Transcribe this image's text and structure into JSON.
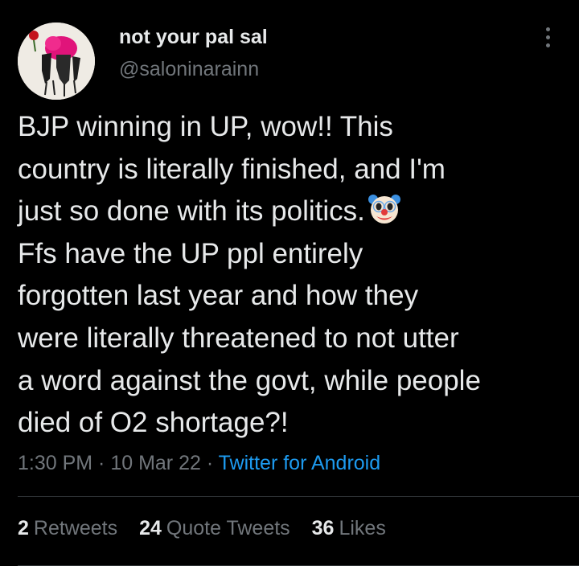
{
  "user": {
    "display_name": "not your pal sal",
    "handle": "@saloninarainn"
  },
  "tweet": {
    "lines": [
      "BJP winning in UP, wow!! This",
      "country is literally finished, and I'm",
      "just so done with its politics.",
      "Ffs have the UP ppl entirely",
      "forgotten last year and how they",
      "were literally threatened to not utter",
      "a word against the govt, while people",
      "died of O2 shortage?!"
    ],
    "emoji": "clown-face"
  },
  "meta": {
    "time": "1:30 PM",
    "sep1": " · ",
    "date": "10 Mar 22",
    "sep2": " · ",
    "source": "Twitter for Android"
  },
  "stats": [
    {
      "count": "2",
      "label": "Retweets"
    },
    {
      "count": "24",
      "label": "Quote Tweets"
    },
    {
      "count": "36",
      "label": "Likes"
    }
  ],
  "colors": {
    "background": "#000000",
    "text": "#e7e9ea",
    "secondary": "#71767b",
    "link": "#1d9bf0",
    "divider": "#2f3336"
  }
}
